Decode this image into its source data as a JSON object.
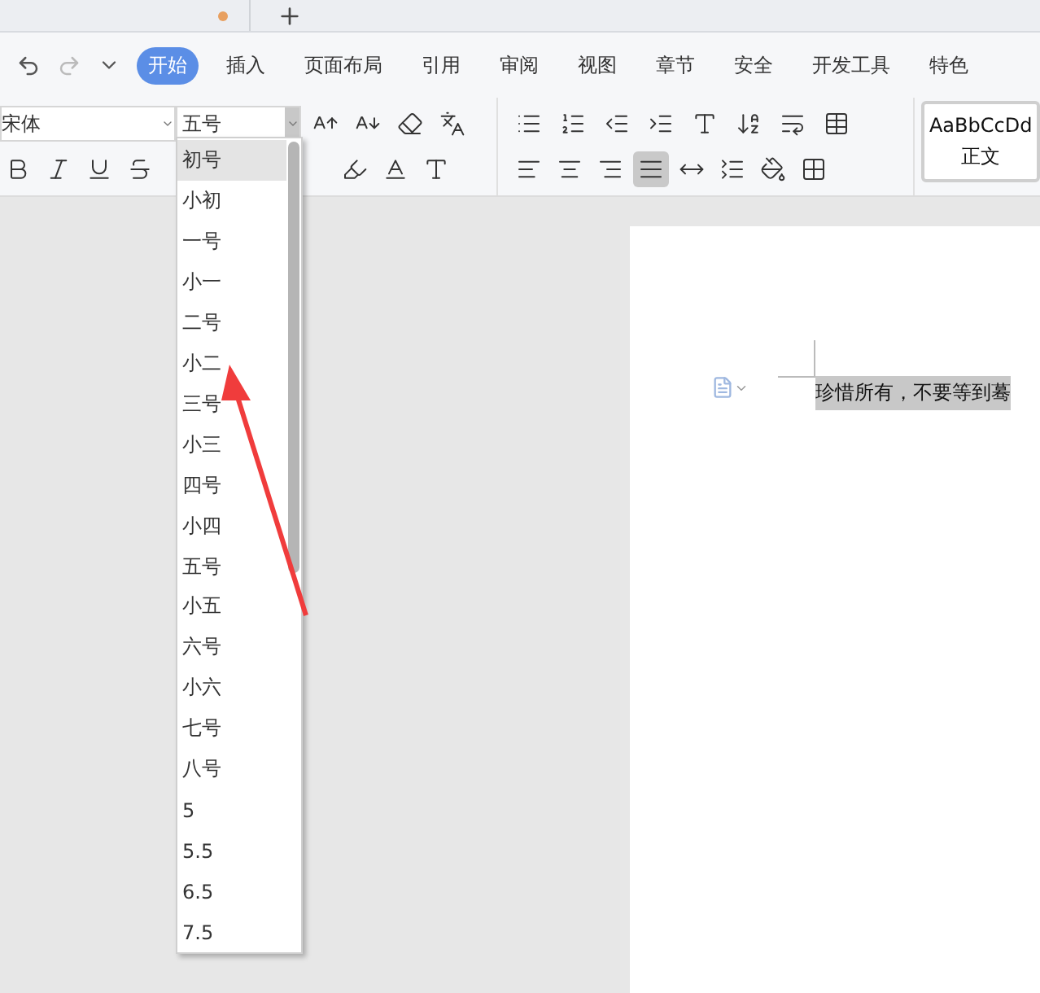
{
  "menu": {
    "tabs": [
      {
        "label": "开始",
        "selected": true
      },
      {
        "label": "插入",
        "selected": false
      },
      {
        "label": "页面布局",
        "selected": false
      },
      {
        "label": "引用",
        "selected": false
      },
      {
        "label": "审阅",
        "selected": false
      },
      {
        "label": "视图",
        "selected": false
      },
      {
        "label": "章节",
        "selected": false
      },
      {
        "label": "安全",
        "selected": false
      },
      {
        "label": "开发工具",
        "selected": false
      },
      {
        "label": "特色",
        "selected": false
      }
    ]
  },
  "font": {
    "family": "宋体",
    "size": "五号"
  },
  "size_options": [
    {
      "label": "初号",
      "selected": true
    },
    {
      "label": "小初",
      "selected": false
    },
    {
      "label": "一号",
      "selected": false
    },
    {
      "label": "小一",
      "selected": false
    },
    {
      "label": "二号",
      "selected": false
    },
    {
      "label": "小二",
      "selected": false
    },
    {
      "label": "三号",
      "selected": false
    },
    {
      "label": "小三",
      "selected": false
    },
    {
      "label": "四号",
      "selected": false
    },
    {
      "label": "小四",
      "selected": false
    },
    {
      "label": "五号",
      "selected": false
    },
    {
      "label": "小五",
      "selected": false
    },
    {
      "label": "六号",
      "selected": false
    },
    {
      "label": "小六",
      "selected": false
    },
    {
      "label": "七号",
      "selected": false
    },
    {
      "label": "八号",
      "selected": false
    },
    {
      "label": "5",
      "selected": false
    },
    {
      "label": "5.5",
      "selected": false
    },
    {
      "label": "6.5",
      "selected": false
    },
    {
      "label": "7.5",
      "selected": false
    }
  ],
  "paragraph_align": [
    {
      "kind": "left",
      "selected": false
    },
    {
      "kind": "center",
      "selected": false
    },
    {
      "kind": "right",
      "selected": false
    },
    {
      "kind": "justify",
      "selected": true
    },
    {
      "kind": "distributed",
      "selected": false
    }
  ],
  "style_preview": {
    "sample": "AaBbCcDd",
    "name": "正文"
  },
  "document": {
    "text": "珍惜所有，不要等到蓦"
  }
}
